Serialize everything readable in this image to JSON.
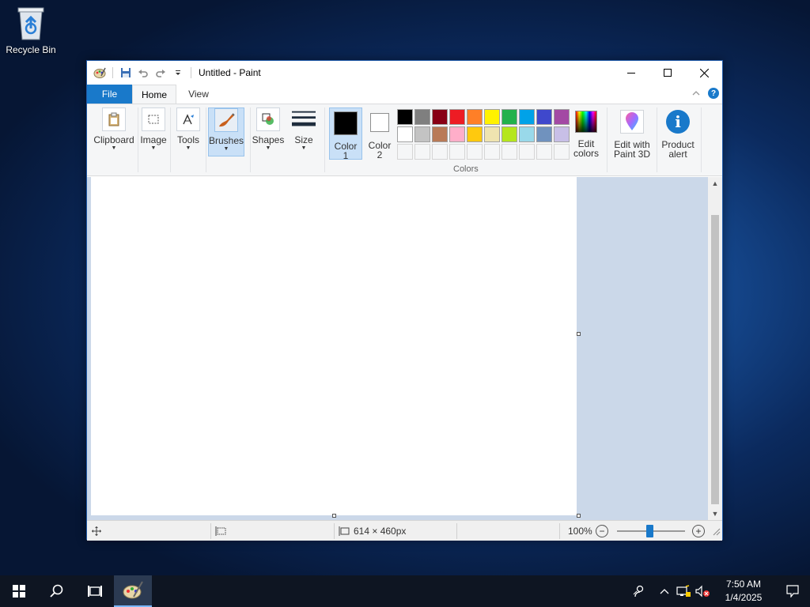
{
  "desktop": {
    "recycle_bin_label": "Recycle Bin"
  },
  "window": {
    "title": "Untitled - Paint",
    "controls": [
      "minimize",
      "maximize",
      "close"
    ]
  },
  "tabs": {
    "file": "File",
    "home": "Home",
    "view": "View",
    "active": "Home"
  },
  "ribbon": {
    "clipboard": "Clipboard",
    "image": "Image",
    "tools": "Tools",
    "brushes": "Brushes",
    "shapes": "Shapes",
    "size": "Size",
    "color1_line1": "Color",
    "color1_line2": "1",
    "color2_line1": "Color",
    "color2_line2": "2",
    "colors_group": "Colors",
    "edit_colors_line1": "Edit",
    "edit_colors_line2": "colors",
    "edit_paint3d_line1": "Edit with",
    "edit_paint3d_line2": "Paint 3D",
    "product_alert_line1": "Product",
    "product_alert_line2": "alert",
    "color1_value": "#000000",
    "color2_value": "#ffffff"
  },
  "palette": {
    "row1": [
      "#000000",
      "#7f7f7f",
      "#880015",
      "#ed1c24",
      "#ff7f27",
      "#fff200",
      "#22b14c",
      "#00a2e8",
      "#3f48cc",
      "#a349a4"
    ],
    "row2": [
      "#ffffff",
      "#c3c3c3",
      "#b97a57",
      "#ffaec9",
      "#ffc90e",
      "#efe4b0",
      "#b5e61d",
      "#99d9ea",
      "#7092be",
      "#c8bfe7"
    ],
    "row3": [
      "#f5f6f7",
      "#f5f6f7",
      "#f5f6f7",
      "#f5f6f7",
      "#f5f6f7",
      "#f5f6f7",
      "#f5f6f7",
      "#f5f6f7",
      "#f5f6f7",
      "#f5f6f7"
    ]
  },
  "status": {
    "canvas_size": "614 × 460px",
    "zoom": "100%"
  },
  "taskbar": {
    "time": "7:50 AM",
    "date": "1/4/2025"
  },
  "colors": {
    "accent": "#1979ca",
    "workspace": "#cbd8e9",
    "taskbar": "#0e1522"
  }
}
